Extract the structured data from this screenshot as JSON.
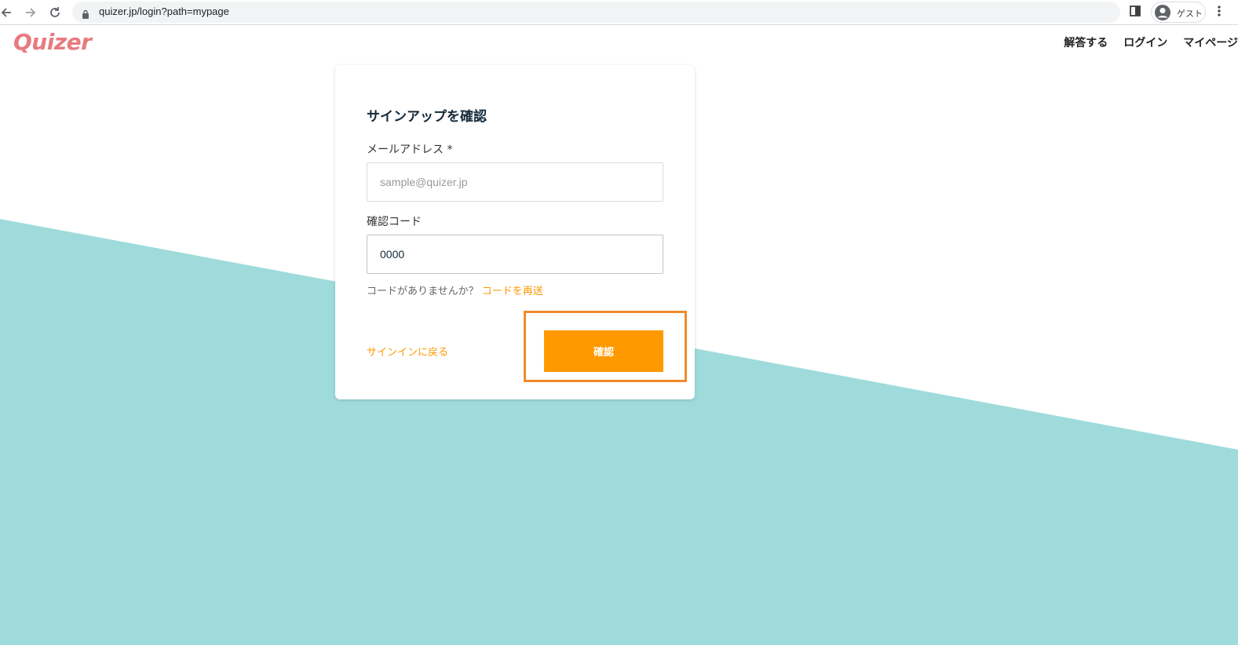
{
  "browser": {
    "url": "quizer.jp/login?path=mypage",
    "profile_label": "ゲスト"
  },
  "header": {
    "logo": "Quizer",
    "nav": [
      "解答する",
      "ログイン",
      "マイページ"
    ]
  },
  "form": {
    "title": "サインアップを確認",
    "email_label": "メールアドレス *",
    "email_placeholder": "sample@quizer.jp",
    "email_value": "",
    "code_label": "確認コード",
    "code_value": "0000",
    "no_code_text": "コードがありませんか？",
    "resend_link": "コードを再送",
    "back_link": "サインインに戻る",
    "confirm_button": "確認"
  },
  "colors": {
    "accent": "#ff9900",
    "background_shape": "#9fdbdb",
    "logo": "#e87a7f",
    "highlight": "#f08a2a"
  }
}
